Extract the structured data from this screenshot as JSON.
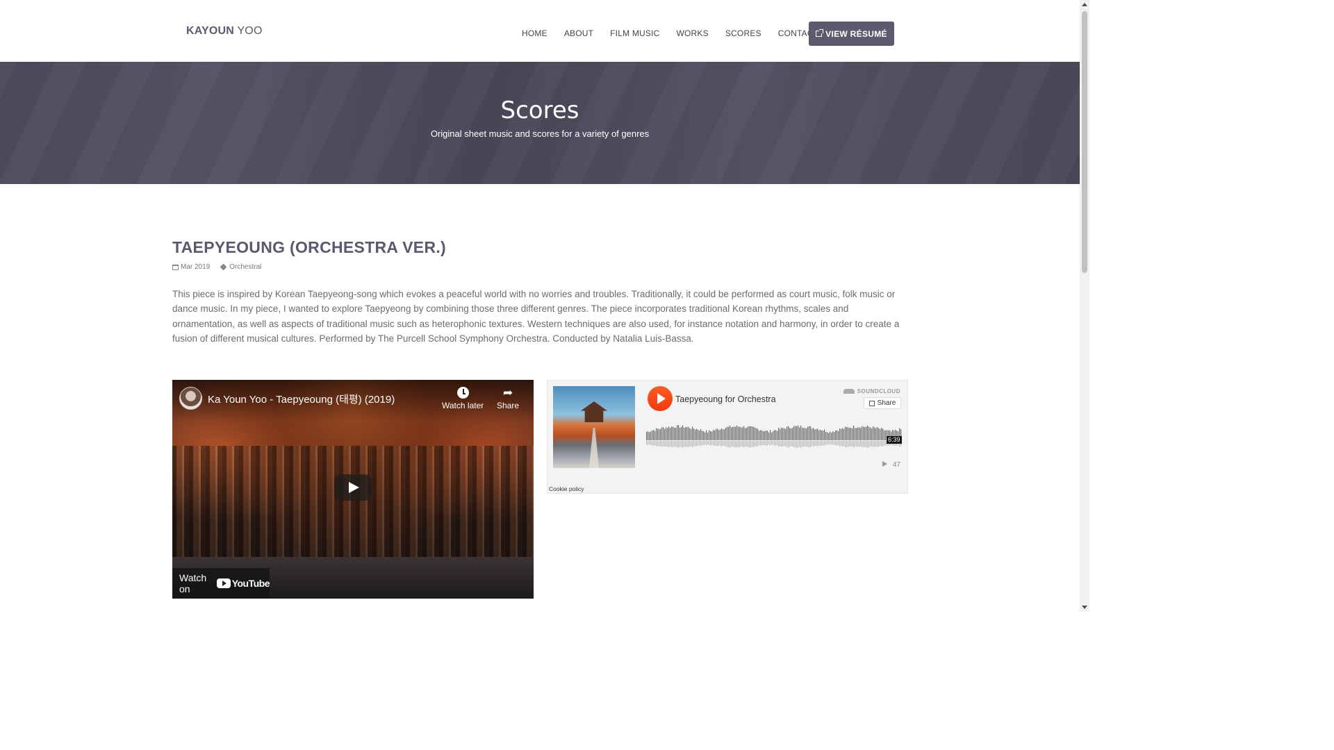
{
  "brand": {
    "first": "KAYOUN",
    "last": "YOO"
  },
  "nav": {
    "items": [
      "HOME",
      "ABOUT",
      "FILM MUSIC",
      "WORKS",
      "SCORES",
      "CONTACT"
    ],
    "resume_label": "VIEW RÉSUMÉ"
  },
  "hero": {
    "title": "Scores",
    "subtitle": "Original sheet music and scores for a variety of genres"
  },
  "post": {
    "title": "TAEPYEOUNG (ORCHESTRA VER.)",
    "date": "Mar 2019",
    "category": "Orchestral",
    "description": "This piece is inspired by Korean Taepyeong-song which evokes a peaceful world with no worries and troubles. Traditionally, it could be performed as court music, folk music or dance music. In my piece, I wanted to explore Taepyeong by combining those three different genres. The piece incorporates traditional Korean rhythms, scales and ornamentation, as well as aspects of traditional music such as heterophonic textures. Western techniques are also used, for instance notation and harmony, in order to create a fusion of different musical cultures. Performed by The Purcell School Symphony Orchestra. Conducted by Natalia Luis-Bassa."
  },
  "youtube": {
    "title": "Ka Youn Yoo - Taepyeoung (태평) (2019)",
    "watch_later": "Watch later",
    "share": "Share",
    "watch_on": "Watch on",
    "logo_text": "YouTube"
  },
  "soundcloud": {
    "brand": "SOUNDCLOUD",
    "share": "Share",
    "track": "Taepyeoung for Orchestra",
    "duration": "6:39",
    "plays": "47",
    "cookie": "Cookie policy"
  },
  "colors": {
    "accent": "#5c5a6e",
    "soundcloud_orange": "#ff5500",
    "hero_bg": "#4f4d5e"
  }
}
